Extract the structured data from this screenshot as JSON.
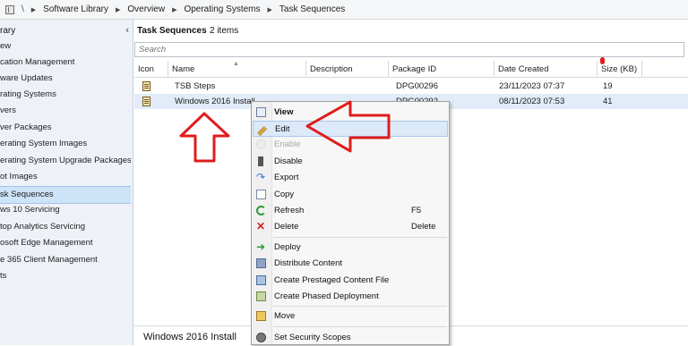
{
  "breadcrumb": {
    "separator": "\\",
    "items": [
      "Software Library",
      "Overview",
      "Operating Systems",
      "Task Sequences"
    ],
    "arrow": "▶"
  },
  "sidebar": {
    "title": "rary",
    "collapse_glyph": "‹",
    "items": [
      {
        "label": "ew",
        "selected": false
      },
      {
        "label": "cation Management",
        "selected": false
      },
      {
        "label": "ware Updates",
        "selected": false
      },
      {
        "label": "rating Systems",
        "selected": false
      },
      {
        "label": "vers",
        "selected": false
      },
      {
        "label": "ver Packages",
        "selected": false
      },
      {
        "label": "erating System Images",
        "selected": false
      },
      {
        "label": "erating System Upgrade Packages",
        "selected": false
      },
      {
        "label": "ot Images",
        "selected": false
      },
      {
        "label": "sk Sequences",
        "selected": true
      },
      {
        "label": "ws 10 Servicing",
        "selected": false
      },
      {
        "label": "top Analytics Servicing",
        "selected": false
      },
      {
        "label": "osoft Edge Management",
        "selected": false
      },
      {
        "label": "e 365 Client Management",
        "selected": false
      },
      {
        "label": "ts",
        "selected": false
      }
    ]
  },
  "main": {
    "title": "Task Sequences",
    "count": "2 items",
    "search_placeholder": "Search",
    "columns": [
      "Icon",
      "Name",
      "Description",
      "Package ID",
      "Date Created",
      "Size (KB)"
    ],
    "rows": [
      {
        "name": "TSB Steps",
        "description": "",
        "package_id": "DPG00296",
        "date_created": "23/11/2023 07:37",
        "size": "19",
        "selected": false
      },
      {
        "name": "Windows 2016 Install",
        "description": "",
        "package_id": "DPG00292",
        "date_created": "08/11/2023 07:53",
        "size": "41",
        "selected": true
      }
    ],
    "details_title": "Windows 2016 Install"
  },
  "context_menu": {
    "items": [
      {
        "label": "View",
        "icon": "view-icon",
        "shortcut": "",
        "bold": true,
        "disabled": false,
        "highlighted": false
      },
      {
        "label": "Edit",
        "icon": "pencil-icon",
        "shortcut": "",
        "bold": false,
        "disabled": false,
        "highlighted": true
      },
      {
        "label": "Enable",
        "icon": "enable-icon",
        "shortcut": "",
        "bold": false,
        "disabled": true,
        "highlighted": false
      },
      {
        "label": "Disable",
        "icon": "disable-icon",
        "shortcut": "",
        "bold": false,
        "disabled": false,
        "highlighted": false
      },
      {
        "label": "Export",
        "icon": "export-arrow-icon",
        "shortcut": "",
        "bold": false,
        "disabled": false,
        "highlighted": false
      },
      {
        "label": "Copy",
        "icon": "copy-icon",
        "shortcut": "",
        "bold": false,
        "disabled": false,
        "highlighted": false
      },
      {
        "label": "Refresh",
        "icon": "refresh-icon",
        "shortcut": "F5",
        "bold": false,
        "disabled": false,
        "highlighted": false
      },
      {
        "label": "Delete",
        "icon": "delete-x-icon",
        "shortcut": "Delete",
        "bold": false,
        "disabled": false,
        "highlighted": false
      },
      {
        "label": "Deploy",
        "icon": "deploy-arrow-icon",
        "shortcut": "",
        "bold": false,
        "disabled": false,
        "highlighted": false
      },
      {
        "label": "Distribute Content",
        "icon": "distribute-content-icon",
        "shortcut": "",
        "bold": false,
        "disabled": false,
        "highlighted": false
      },
      {
        "label": "Create Prestaged Content File",
        "icon": "prestaged-content-icon",
        "shortcut": "",
        "bold": false,
        "disabled": false,
        "highlighted": false
      },
      {
        "label": "Create Phased Deployment",
        "icon": "phased-deployment-icon",
        "shortcut": "",
        "bold": false,
        "disabled": false,
        "highlighted": false
      },
      {
        "label": "Move",
        "icon": "folder-move-icon",
        "shortcut": "",
        "bold": false,
        "disabled": false,
        "highlighted": false
      },
      {
        "label": "Set Security Scopes",
        "icon": "security-scopes-icon",
        "shortcut": "",
        "bold": false,
        "disabled": false,
        "highlighted": false
      }
    ]
  },
  "colors": {
    "selection": "#cde3f7",
    "menu_highlight": "#dbe9f8",
    "annotation_red": "#e01c1c"
  }
}
